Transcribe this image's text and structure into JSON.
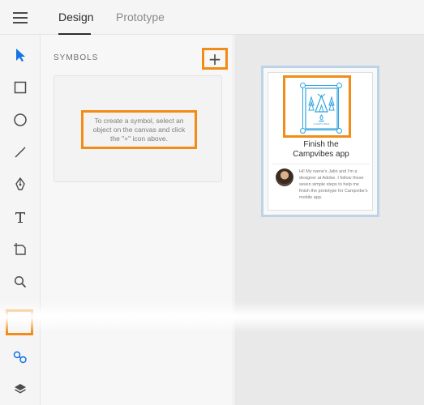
{
  "header": {
    "tabs": [
      {
        "label": "Design"
      },
      {
        "label": "Prototype"
      }
    ]
  },
  "panel": {
    "title": "SYMBOLS",
    "add_label": "+",
    "hint": "To create a symbol, select an object on the canvas and click the \"+\" icon above."
  },
  "artboard": {
    "title": "Finish the\nCampvibes app",
    "body": "Hi! My name's Jalin and I'm a designer at Adobe. I follow these seven simple steps to help me finish the prototype for Campvibe's mobile app.",
    "logo_text": "CAMPVIBES"
  },
  "tools": [
    {
      "icon": "select-arrow-icon"
    },
    {
      "icon": "rectangle-icon"
    },
    {
      "icon": "ellipse-icon"
    },
    {
      "icon": "line-icon"
    },
    {
      "icon": "pen-icon"
    },
    {
      "icon": "text-icon"
    },
    {
      "icon": "artboard-icon"
    },
    {
      "icon": "zoom-icon"
    },
    {
      "icon": "symbols-icon"
    },
    {
      "icon": "layers-icon"
    }
  ],
  "colors": {
    "highlight": "#f28c16",
    "selection": "#2fa4e0",
    "accent": "#1473e6",
    "artboard_border": "#bcd3e8"
  }
}
